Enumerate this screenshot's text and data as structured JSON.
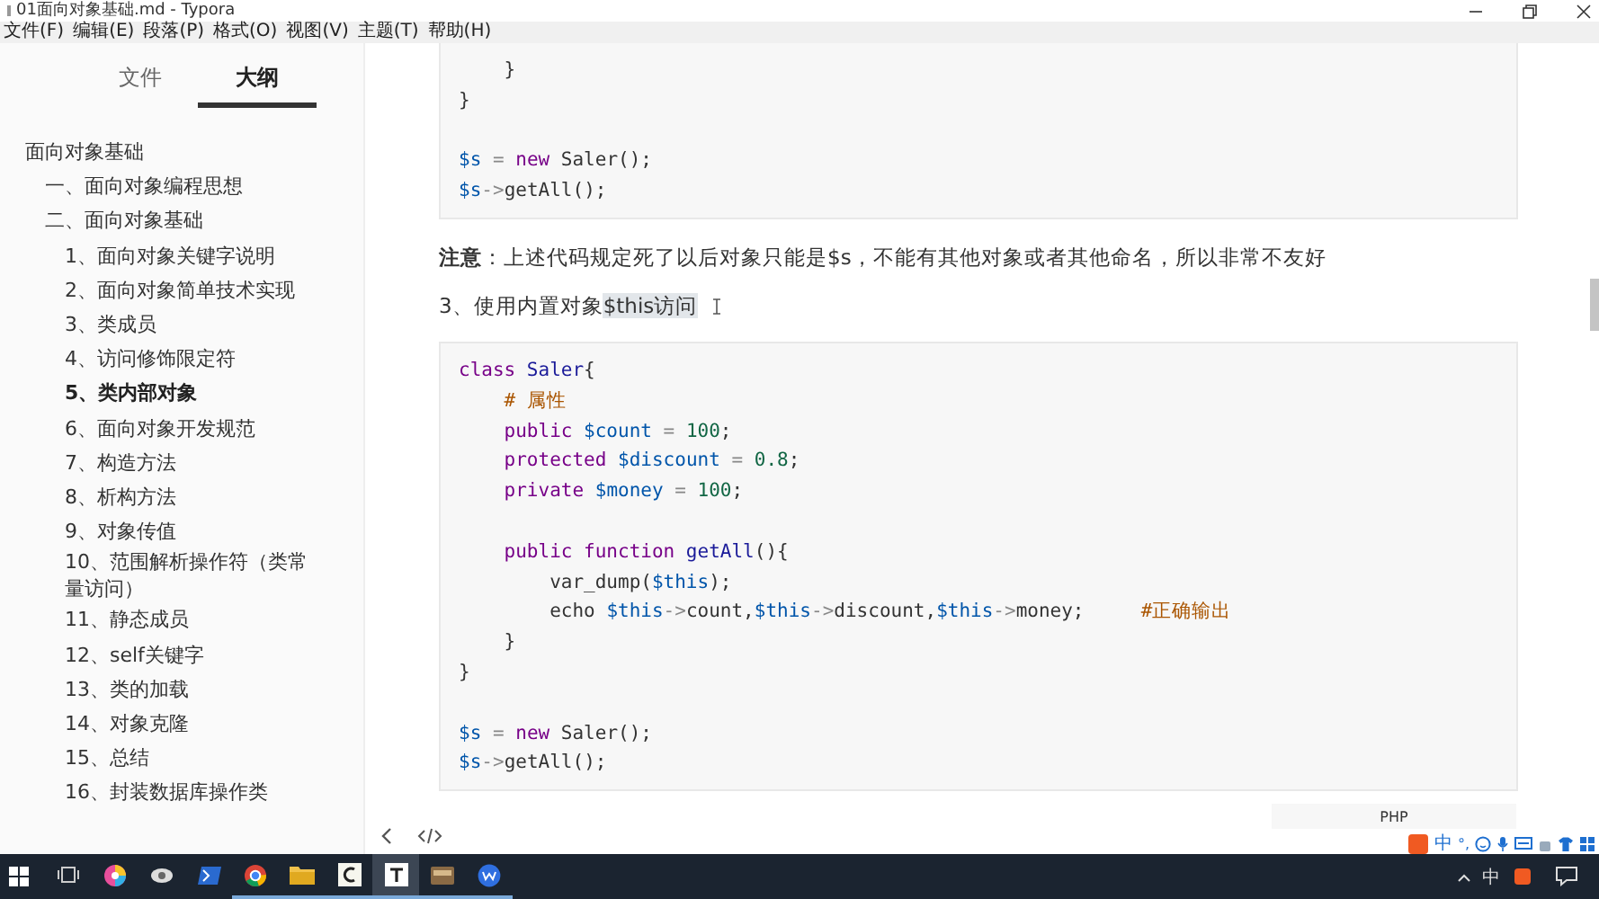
{
  "window": {
    "title": "01面向对象基础.md - Typora"
  },
  "menu": [
    "文件(F)",
    "编辑(E)",
    "段落(P)",
    "格式(O)",
    "视图(V)",
    "主题(T)",
    "帮助(H)"
  ],
  "sidebar": {
    "tabs": [
      {
        "label": "文件",
        "selected": false
      },
      {
        "label": "大纲",
        "selected": true
      }
    ],
    "outline": [
      {
        "label": "面向对象基础",
        "selected": false,
        "children": [
          {
            "label": "一、面向对象编程思想",
            "selected": false
          },
          {
            "label": "二、面向对象基础",
            "selected": false,
            "children": [
              {
                "label": "1、面向对象关键字说明",
                "selected": false
              },
              {
                "label": "2、面向对象简单技术实现",
                "selected": false
              },
              {
                "label": "3、类成员",
                "selected": false
              },
              {
                "label": "4、访问修饰限定符",
                "selected": false
              },
              {
                "label": "5、类内部对象",
                "selected": true
              },
              {
                "label": "6、面向对象开发规范",
                "selected": false
              },
              {
                "label": "7、构造方法",
                "selected": false
              },
              {
                "label": "8、析构方法",
                "selected": false
              },
              {
                "label": "9、对象传值",
                "selected": false
              },
              {
                "label": "10、范围解析操作符（类常量访问）",
                "selected": false
              },
              {
                "label": "11、静态成员",
                "selected": false
              },
              {
                "label": "12、self关键字",
                "selected": false
              },
              {
                "label": "13、类的加载",
                "selected": false
              },
              {
                "label": "14、对象克隆",
                "selected": false
              },
              {
                "label": "15、总结",
                "selected": false
              },
              {
                "label": "16、封装数据库操作类",
                "selected": false
              }
            ]
          }
        ]
      }
    ]
  },
  "editor": {
    "blocks": [
      {
        "kind": "code",
        "lines": [
          {
            "gap_before": false,
            "segments": [
              {
                "text": "    }",
                "kind": "plain"
              }
            ]
          },
          {
            "gap_before": false,
            "segments": [
              {
                "text": "}",
                "kind": "plain"
              }
            ]
          },
          {
            "gap_before": true,
            "segments": [
              {
                "text": "$s",
                "kind": "var"
              },
              {
                "text": " = ",
                "kind": "op"
              },
              {
                "text": "new",
                "kind": "kw"
              },
              {
                "text": " Saler();",
                "kind": "plain"
              }
            ]
          },
          {
            "gap_before": false,
            "segments": [
              {
                "text": "$s",
                "kind": "var"
              },
              {
                "text": "->",
                "kind": "op"
              },
              {
                "text": "getAll();",
                "kind": "plain"
              }
            ]
          }
        ]
      },
      {
        "kind": "paragraph",
        "text": "**注意**：上述代码规定死了以后对象只能是$s，不能有其他对象或者其他命名，所以非常不友好"
      },
      {
        "kind": "heading",
        "segments": [
          {
            "text": "3、使用内置对象",
            "highlighted": false
          },
          {
            "text": "$this访问",
            "highlighted": true
          }
        ]
      },
      {
        "kind": "code",
        "language": "PHP",
        "lines": [
          {
            "gap_before": false,
            "segments": [
              {
                "text": "class",
                "kind": "kw"
              },
              {
                "text": " Saler",
                "kind": "def"
              },
              {
                "text": "{",
                "kind": "plain"
              }
            ]
          },
          {
            "gap_before": false,
            "segments": [
              {
                "text": "    # 属性",
                "kind": "comment"
              }
            ]
          },
          {
            "gap_before": false,
            "segments": [
              {
                "text": "    public",
                "kind": "kw"
              },
              {
                "text": " $count",
                "kind": "var"
              },
              {
                "text": " = ",
                "kind": "op"
              },
              {
                "text": "100",
                "kind": "num"
              },
              {
                "text": ";",
                "kind": "plain"
              }
            ]
          },
          {
            "gap_before": false,
            "segments": [
              {
                "text": "    protected",
                "kind": "kw"
              },
              {
                "text": " $discount",
                "kind": "var"
              },
              {
                "text": " = ",
                "kind": "op"
              },
              {
                "text": "0.8",
                "kind": "num"
              },
              {
                "text": ";",
                "kind": "plain"
              }
            ]
          },
          {
            "gap_before": false,
            "segments": [
              {
                "text": "    private",
                "kind": "kw"
              },
              {
                "text": " $money",
                "kind": "var"
              },
              {
                "text": " = ",
                "kind": "op"
              },
              {
                "text": "100",
                "kind": "num"
              },
              {
                "text": ";",
                "kind": "plain"
              }
            ]
          },
          {
            "gap_before": true,
            "segments": [
              {
                "text": "    public function",
                "kind": "kw"
              },
              {
                "text": " getAll",
                "kind": "def"
              },
              {
                "text": "(){",
                "kind": "plain"
              }
            ]
          },
          {
            "gap_before": false,
            "segments": [
              {
                "text": "        var_dump(",
                "kind": "plain"
              },
              {
                "text": "$this",
                "kind": "var"
              },
              {
                "text": ");",
                "kind": "plain"
              }
            ]
          },
          {
            "gap_before": false,
            "segments": [
              {
                "text": "        echo ",
                "kind": "plain"
              },
              {
                "text": "$this",
                "kind": "var"
              },
              {
                "text": "->",
                "kind": "op"
              },
              {
                "text": "count,",
                "kind": "plain"
              },
              {
                "text": "$this",
                "kind": "var"
              },
              {
                "text": "->",
                "kind": "op"
              },
              {
                "text": "discount,",
                "kind": "plain"
              },
              {
                "text": "$this",
                "kind": "var"
              },
              {
                "text": "->",
                "kind": "op"
              },
              {
                "text": "money;",
                "kind": "plain"
              },
              {
                "text": "     #正确输出",
                "kind": "comment"
              }
            ]
          },
          {
            "gap_before": false,
            "segments": [
              {
                "text": "    }",
                "kind": "plain"
              }
            ]
          },
          {
            "gap_before": false,
            "segments": [
              {
                "text": "}",
                "kind": "plain"
              }
            ]
          },
          {
            "gap_before": true,
            "segments": [
              {
                "text": "$s",
                "kind": "var"
              },
              {
                "text": " = ",
                "kind": "op"
              },
              {
                "text": "new",
                "kind": "kw"
              },
              {
                "text": " Saler();",
                "kind": "plain"
              }
            ]
          },
          {
            "gap_before": false,
            "segments": [
              {
                "text": "$s",
                "kind": "var"
              },
              {
                "text": "->",
                "kind": "op"
              },
              {
                "text": "getAll();",
                "kind": "plain"
              }
            ]
          }
        ]
      }
    ]
  },
  "ime_bar": {
    "mode": "中",
    "punct": "°,"
  },
  "taskbar": {
    "apps": [
      {
        "kind": "taskview",
        "running": false,
        "selected": false
      },
      {
        "kind": "colorful",
        "running": false,
        "selected": false
      },
      {
        "kind": "eye",
        "running": false,
        "selected": false
      },
      {
        "kind": "shell",
        "running": false,
        "selected": false
      },
      {
        "kind": "browser",
        "running": true,
        "selected": false
      },
      {
        "kind": "folder",
        "running": true,
        "selected": false
      },
      {
        "kind": "editor",
        "running": true,
        "selected": false
      },
      {
        "kind": "typora",
        "running": true,
        "selected": true
      },
      {
        "kind": "box",
        "running": true,
        "selected": false
      },
      {
        "kind": "wps",
        "running": true,
        "selected": false
      }
    ],
    "tray_language": "中"
  }
}
